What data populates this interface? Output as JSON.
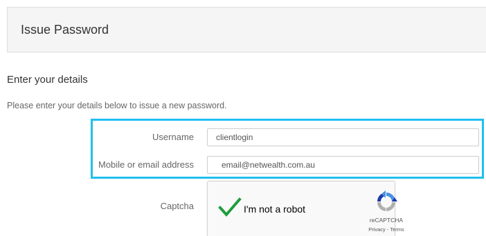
{
  "header": {
    "title": "Issue Password"
  },
  "section": {
    "heading": "Enter your details",
    "description": "Please enter your details below to issue a new password."
  },
  "form": {
    "username": {
      "label": "Username",
      "value": "clientlogin"
    },
    "contact": {
      "label": "Mobile or email address",
      "value": "email@netwealth.com.au"
    },
    "captcha": {
      "label": "Captcha"
    }
  },
  "recaptcha": {
    "checkbox_label": "I'm not a robot",
    "checked": true,
    "brand": "reCAPTCHA",
    "privacy": "Privacy",
    "separator": " - ",
    "terms": "Terms",
    "check_icon": "checkmark-icon",
    "logo_icon": "recaptcha-logo-icon"
  },
  "colors": {
    "highlight": "#1fbfef",
    "check": "#1e9e3a",
    "recaptcha_blue": "#4a90e2",
    "recaptcha_dark": "#1c3aa9",
    "recaptcha_grey": "#b0b0b0"
  }
}
